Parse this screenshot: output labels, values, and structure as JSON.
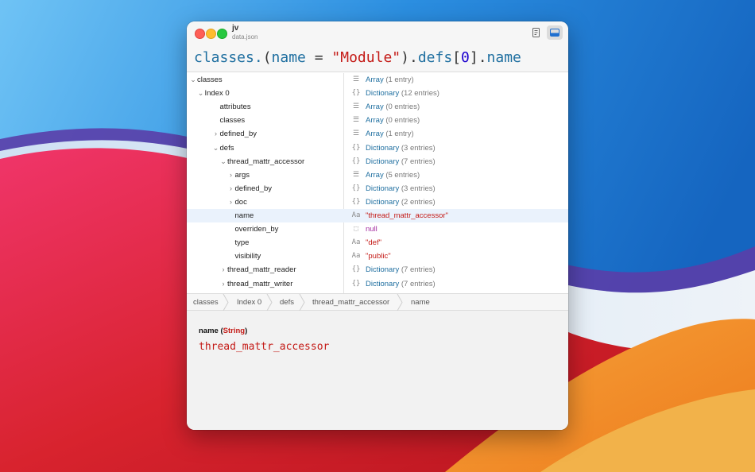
{
  "window": {
    "title": "jv",
    "subtitle": "data.json",
    "doc_button_icon": "document-icon",
    "panel_button_icon": "sidebar-bottom-icon"
  },
  "query": {
    "p1": "classes.",
    "p2": "(",
    "p3": "name",
    "p4": " = ",
    "p5": "\"Module\"",
    "p6": ")",
    "p7": ".",
    "p8": "defs",
    "p9": "[",
    "p10": "0",
    "p11": "]",
    "p12": ".",
    "p13": "name"
  },
  "tree": {
    "rows": [
      {
        "key": "classes",
        "chevron": "⌄",
        "type_icon": "☰",
        "type_name": "Array",
        "count": "(1 entry)",
        "value": "",
        "value_kind": ""
      },
      {
        "key": "Index 0",
        "chevron": "⌄",
        "type_icon": "{}",
        "type_name": "Dictionary",
        "count": "(12 entries)",
        "value": "",
        "value_kind": ""
      },
      {
        "key": "attributes",
        "chevron": "",
        "type_icon": "☰",
        "type_name": "Array",
        "count": "(0 entries)",
        "value": "",
        "value_kind": ""
      },
      {
        "key": "classes",
        "chevron": "",
        "type_icon": "☰",
        "type_name": "Array",
        "count": "(0 entries)",
        "value": "",
        "value_kind": ""
      },
      {
        "key": "defined_by",
        "chevron": "›",
        "type_icon": "☰",
        "type_name": "Array",
        "count": "(1 entry)",
        "value": "",
        "value_kind": ""
      },
      {
        "key": "defs",
        "chevron": "⌄",
        "type_icon": "{}",
        "type_name": "Dictionary",
        "count": "(3 entries)",
        "value": "",
        "value_kind": ""
      },
      {
        "key": "thread_mattr_accessor",
        "chevron": "⌄",
        "type_icon": "{}",
        "type_name": "Dictionary",
        "count": "(7 entries)",
        "value": "",
        "value_kind": ""
      },
      {
        "key": "args",
        "chevron": "›",
        "type_icon": "☰",
        "type_name": "Array",
        "count": "(5 entries)",
        "value": "",
        "value_kind": ""
      },
      {
        "key": "defined_by",
        "chevron": "›",
        "type_icon": "{}",
        "type_name": "Dictionary",
        "count": "(3 entries)",
        "value": "",
        "value_kind": ""
      },
      {
        "key": "doc",
        "chevron": "›",
        "type_icon": "{}",
        "type_name": "Dictionary",
        "count": "(2 entries)",
        "value": "",
        "value_kind": ""
      },
      {
        "key": "name",
        "chevron": "",
        "type_icon": "Aa",
        "type_name": "",
        "count": "",
        "value": "\"thread_mattr_accessor\"",
        "value_kind": "string",
        "selected": true
      },
      {
        "key": "overriden_by",
        "chevron": "",
        "type_icon": "⬚",
        "type_name": "",
        "count": "",
        "value": "null",
        "value_kind": "null"
      },
      {
        "key": "type",
        "chevron": "",
        "type_icon": "Aa",
        "type_name": "",
        "count": "",
        "value": "\"def\"",
        "value_kind": "string"
      },
      {
        "key": "visibility",
        "chevron": "",
        "type_icon": "Aa",
        "type_name": "",
        "count": "",
        "value": "\"public\"",
        "value_kind": "string"
      },
      {
        "key": "thread_mattr_reader",
        "chevron": "›",
        "type_icon": "{}",
        "type_name": "Dictionary",
        "count": "(7 entries)",
        "value": "",
        "value_kind": ""
      },
      {
        "key": "thread_mattr_writer",
        "chevron": "›",
        "type_icon": "{}",
        "type_name": "Dictionary",
        "count": "(7 entries)",
        "value": "",
        "value_kind": ""
      }
    ]
  },
  "breadcrumb": [
    "classes",
    "Index 0",
    "defs",
    "thread_mattr_accessor",
    "name"
  ],
  "detail": {
    "name": "name",
    "type_open": " (",
    "type": "String",
    "type_close": ")",
    "value": "thread_mattr_accessor"
  },
  "colors": {
    "type_link": "#1f6fa0",
    "string_value": "#c41a16",
    "null_value": "#a32aa0",
    "selection": "#eaf2fc"
  }
}
